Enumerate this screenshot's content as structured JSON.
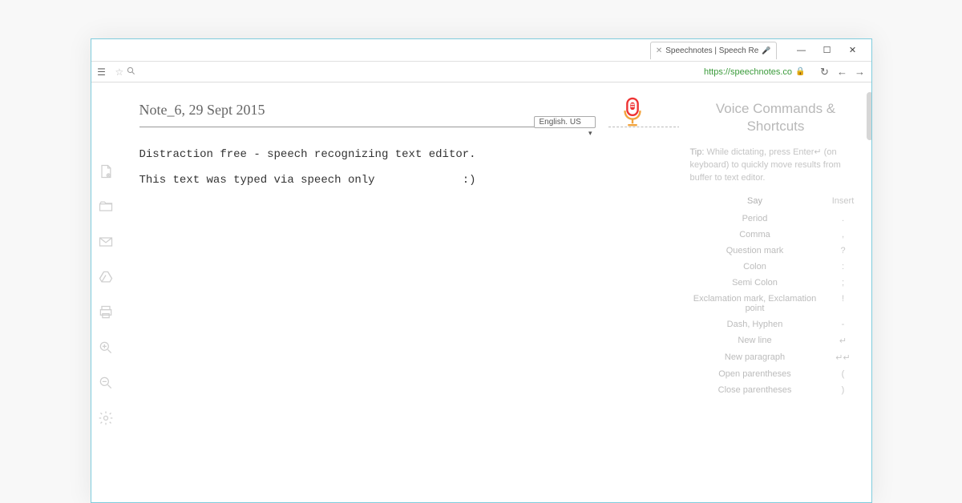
{
  "window": {
    "tab_title": "Speechnotes | Speech Re",
    "controls": {
      "minimize": "—",
      "maximize": "☐",
      "close": "✕"
    }
  },
  "addressbar": {
    "url": "https://speechnotes.co"
  },
  "note": {
    "title": "Note_6, 29 Sept 2015",
    "language": "English. US",
    "body_line1": "Distraction free - speech recognizing text editor.",
    "body_line2": "This text was typed via speech only             :)"
  },
  "sidebar": {
    "heading": "Voice Commands & Shortcuts",
    "tip_label": "Tip:",
    "tip_body": "While dictating, press Enter↵ (on keyboard) to quickly move results from buffer to text editor.",
    "col_say": "Say",
    "col_insert": "Insert",
    "commands": [
      {
        "say": "Period",
        "insert": "."
      },
      {
        "say": "Comma",
        "insert": ","
      },
      {
        "say": "Question mark",
        "insert": "?"
      },
      {
        "say": "Colon",
        "insert": ":"
      },
      {
        "say": "Semi Colon",
        "insert": ";"
      },
      {
        "say": "Exclamation mark, Exclamation point",
        "insert": "!"
      },
      {
        "say": "Dash, Hyphen",
        "insert": "-"
      },
      {
        "say": "New line",
        "insert": "↵"
      },
      {
        "say": "New paragraph",
        "insert": "↵↵"
      },
      {
        "say": "Open parentheses",
        "insert": "("
      },
      {
        "say": "Close parentheses",
        "insert": ")"
      }
    ]
  }
}
